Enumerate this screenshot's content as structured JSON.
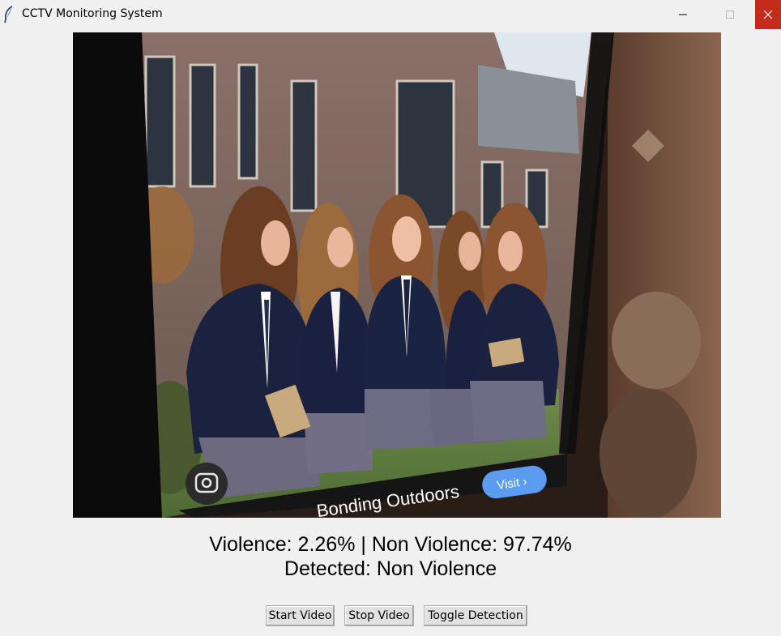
{
  "window": {
    "title": "CCTV Monitoring System",
    "colors": {
      "close_button": "#c42b1c",
      "background": "#f0f0f0"
    }
  },
  "video_feed": {
    "overlay_caption": "Bonding Outdoors",
    "overlay_button": "Visit ›"
  },
  "status": {
    "probabilities": "Violence: 2.26% | Non Violence: 97.74%",
    "detected": "Detected: Non Violence"
  },
  "controls": {
    "start_label": "Start Video",
    "stop_label": "Stop Video",
    "toggle_label": "Toggle Detection"
  },
  "icons": {
    "app": "feather-icon",
    "minimize": "minimize-icon",
    "maximize": "maximize-icon",
    "close": "close-icon",
    "lens": "camera-lens-icon"
  }
}
